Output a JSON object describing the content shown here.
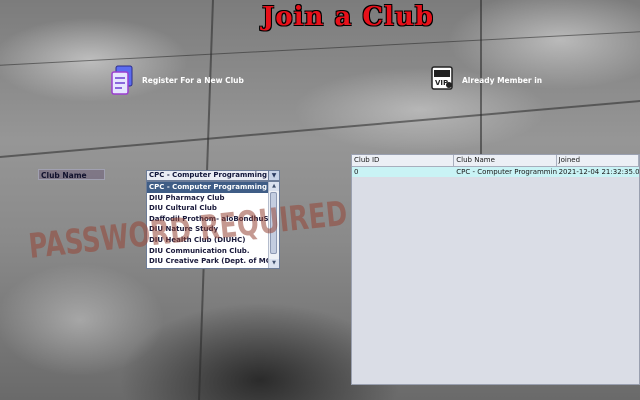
{
  "page": {
    "title": "Join a Club"
  },
  "actions": {
    "register": {
      "label": "Register For a New Club",
      "icon": "register-form-icon"
    },
    "member": {
      "label": "Already Member in",
      "icon": "vip-card-icon"
    }
  },
  "form": {
    "club_label": "Club Name",
    "combo": {
      "selected_display": "CPC - Computer Programming ...",
      "options": [
        "CPC - Computer Programming Club",
        "DIU Pharmacy Club",
        "DIU Cultural Club",
        "Daffodil Prothom- aloBondhuShova",
        "DIU Nature Study",
        "DIU Health Club (DIUHC)",
        "DIU Communication Club.",
        "DIU Creative Park (Dept. of MCT)"
      ]
    }
  },
  "table": {
    "columns": [
      "Club ID",
      "Club Name",
      "Joined"
    ],
    "rows": [
      [
        "0",
        "CPC - Computer Programmin...",
        "2021-12-04 21:32:35.0"
      ]
    ]
  },
  "background_text": "PASSWORD REQUIRED",
  "colors": {
    "title": "#e8101a",
    "selection": "#3f5d86",
    "row_highlight": "#c9f3f5"
  }
}
